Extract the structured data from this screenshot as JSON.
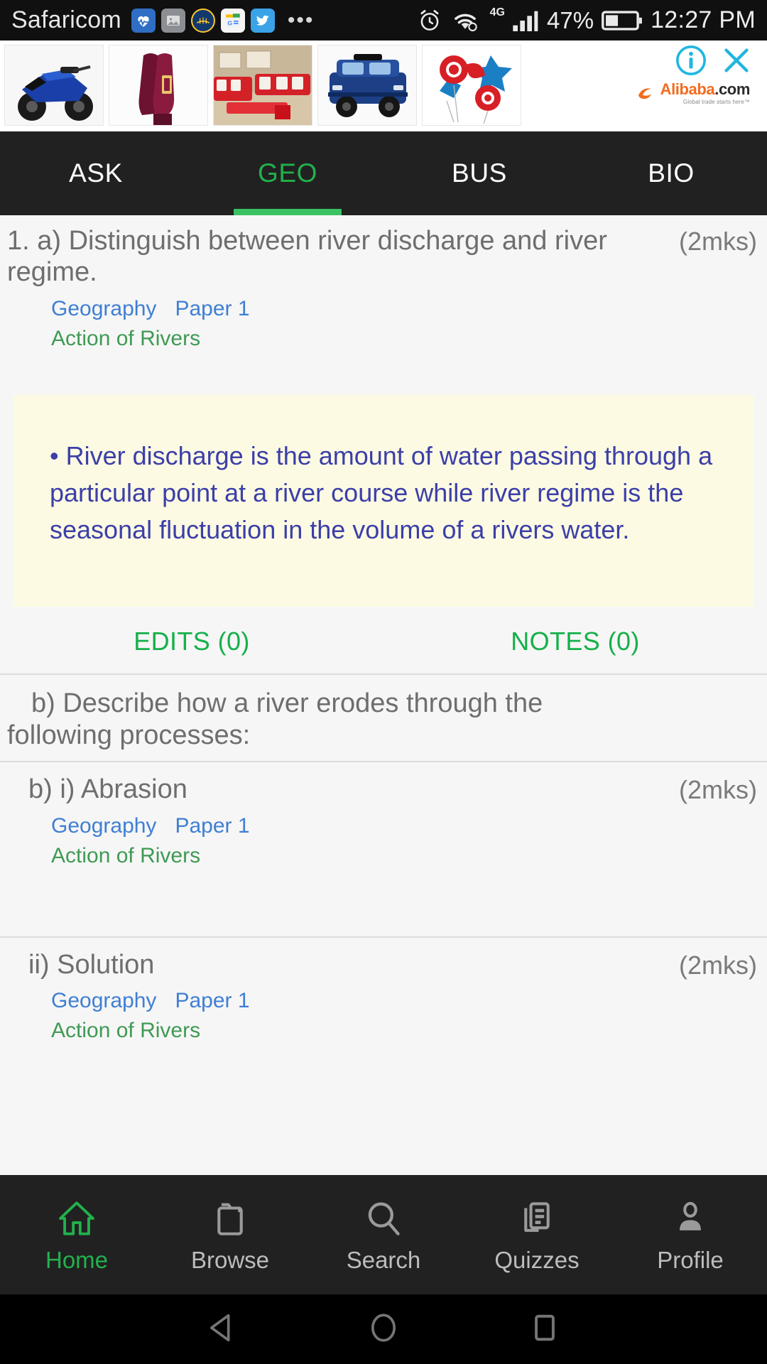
{
  "statusbar": {
    "carrier": "Safaricom",
    "notification_icons": [
      "health-icon",
      "gallery-icon",
      "basketball-team-icon",
      "google-news-icon",
      "twitter-icon"
    ],
    "overflow": "•••",
    "alarm_icon": "alarm-icon",
    "wifi_icon": "wifi-icon",
    "network_type": "4G",
    "signal_icon": "cellular-signal-icon",
    "battery_percent": "47%",
    "battery_icon": "battery-icon",
    "clock": "12:27 PM"
  },
  "ad": {
    "advertiser": "Alibaba",
    "advertiser_domain": ".com",
    "tagline": "Global trade starts here™",
    "info_icon": "info-icon",
    "close_icon": "close-icon",
    "accent_color": "#21b6e0",
    "products": [
      {
        "name": "kids-electric-motorbike"
      },
      {
        "name": "maroon-ankle-boots"
      },
      {
        "name": "red-white-sofa-set"
      },
      {
        "name": "blue-kids-ride-on-suv"
      },
      {
        "name": "number-five-foil-balloons"
      }
    ]
  },
  "tabs": {
    "active_index": 1,
    "active_color": "#22b14c",
    "items": [
      {
        "label": "ASK"
      },
      {
        "label": "GEO"
      },
      {
        "label": "BUS"
      },
      {
        "label": "BIO"
      }
    ]
  },
  "main": {
    "question": {
      "text": "1. a) Distinguish between river discharge and river regime.",
      "marks": "(2mks)",
      "subject": "Geography",
      "paper": "Paper 1",
      "topic": "Action of Rivers"
    },
    "answer": {
      "text": "• River discharge is the amount of water passing through a particular point at a river course while river regime is the seasonal fluctuation in the volume of a rivers water."
    },
    "actions": {
      "edits": "EDITS (0)",
      "notes": "NOTES (0)"
    },
    "part_b_intro": {
      "line1": "b) Describe how a river erodes through the",
      "line2": "following processes:"
    },
    "subquestions": [
      {
        "text": "b) i) Abrasion",
        "marks": "(2mks)",
        "subject": "Geography",
        "paper": "Paper 1",
        "topic": "Action of Rivers"
      },
      {
        "text": "ii) Solution",
        "marks": "(2mks)",
        "subject": "Geography",
        "paper": "Paper 1",
        "topic": "Action of Rivers"
      }
    ]
  },
  "bottom_nav": {
    "active_index": 0,
    "active_color": "#22b14c",
    "items": [
      {
        "label": "Home",
        "icon": "home-icon"
      },
      {
        "label": "Browse",
        "icon": "folder-icon"
      },
      {
        "label": "Search",
        "icon": "search-icon"
      },
      {
        "label": "Quizzes",
        "icon": "quiz-document-icon"
      },
      {
        "label": "Profile",
        "icon": "person-icon"
      }
    ]
  },
  "android_nav": {
    "back": "back-triangle-icon",
    "home": "home-circle-icon",
    "recents": "recents-square-icon"
  }
}
